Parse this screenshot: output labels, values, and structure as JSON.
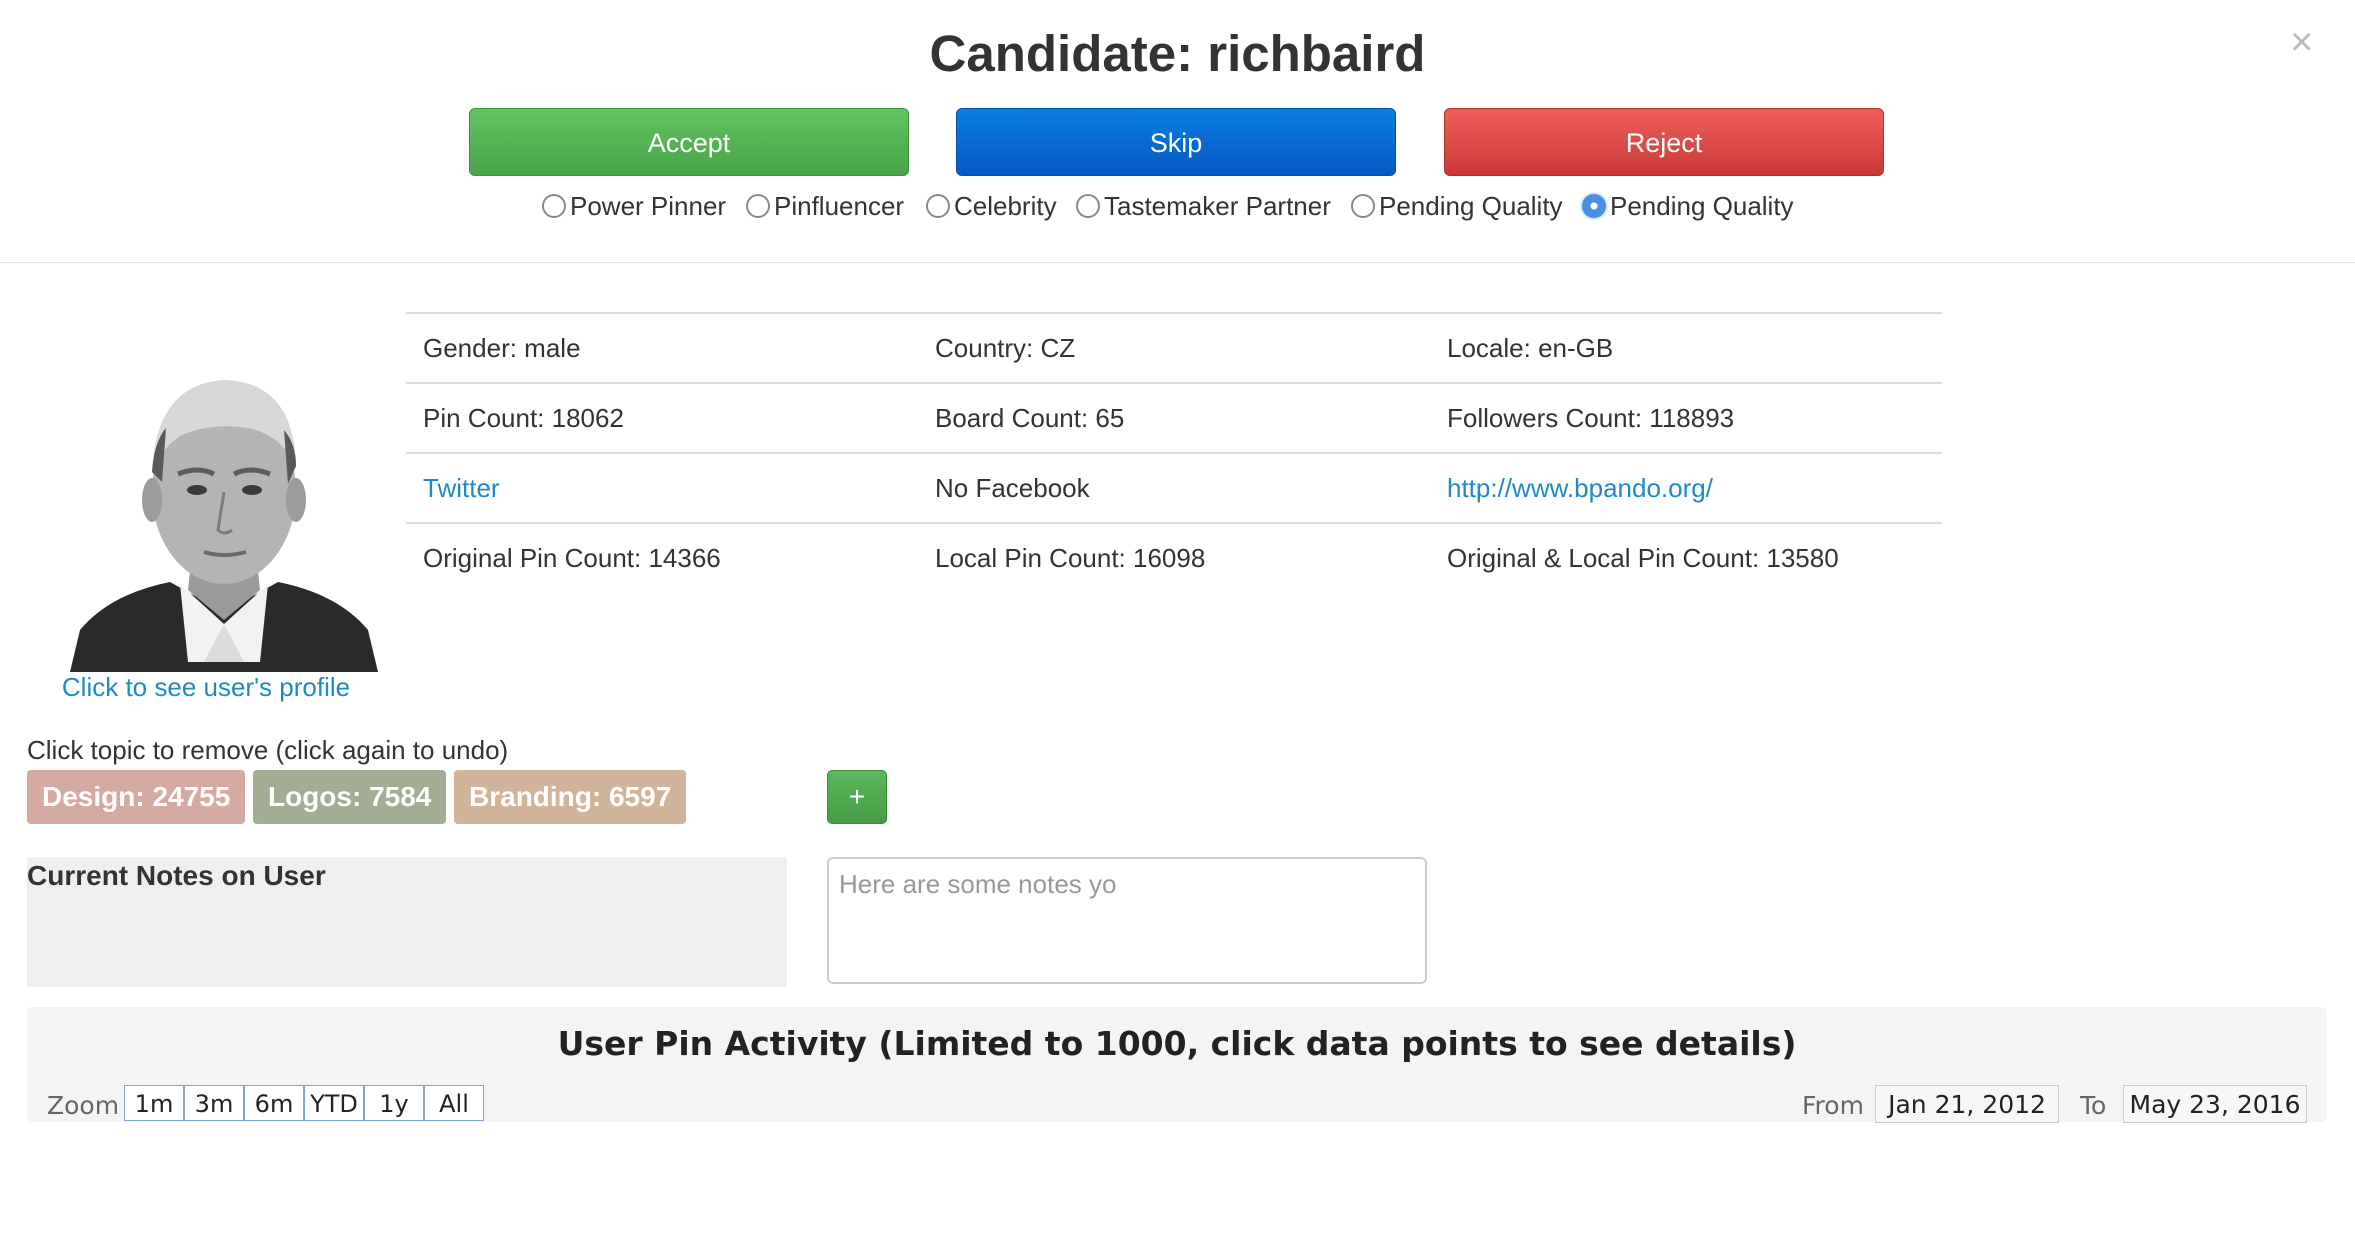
{
  "header": {
    "title": "Candidate: richbaird",
    "close_glyph": "×"
  },
  "actions": {
    "accept": "Accept",
    "skip": "Skip",
    "reject": "Reject"
  },
  "categories": [
    {
      "label": "Power Pinner",
      "checked": false
    },
    {
      "label": "Pinfluencer",
      "checked": false
    },
    {
      "label": "Celebrity",
      "checked": false
    },
    {
      "label": "Tastemaker Partner",
      "checked": false
    },
    {
      "label": "Pending Quality",
      "checked": false
    },
    {
      "label": "Pending Quality",
      "checked": true
    }
  ],
  "profile": {
    "link_text": "Click to see user's profile"
  },
  "info": {
    "gender": "Gender: male",
    "country": "Country: CZ",
    "locale": "Locale: en-GB",
    "pin_count": "Pin Count: 18062",
    "board_count": "Board Count: 65",
    "followers_count": "Followers Count: 118893",
    "twitter": "Twitter",
    "facebook": "No Facebook",
    "website": "http://www.bpando.org/",
    "original_pin_count": "Original Pin Count: 14366",
    "local_pin_count": "Local Pin Count: 16098",
    "original_local_pin_count": "Original & Local Pin Count: 13580"
  },
  "topics": {
    "hint": "Click topic to remove (click again to undo)",
    "items": [
      {
        "label": "Design: 24755",
        "color": "#d4aaa3"
      },
      {
        "label": "Logos: 7584",
        "color": "#a3ad94"
      },
      {
        "label": "Branding: 6597",
        "color": "#d2b49a"
      }
    ],
    "add_label": "+"
  },
  "notes": {
    "heading": "Current Notes on User",
    "placeholder": "Here are some notes yo"
  },
  "activity": {
    "title": "User Pin Activity (Limited to 1000, click data points to see details)",
    "zoom_label": "Zoom",
    "zoom_options": [
      "1m",
      "3m",
      "6m",
      "YTD",
      "1y",
      "All"
    ],
    "from_label": "From",
    "from_value": "Jan 21, 2012",
    "to_label": "To",
    "to_value": "May 23, 2016"
  }
}
